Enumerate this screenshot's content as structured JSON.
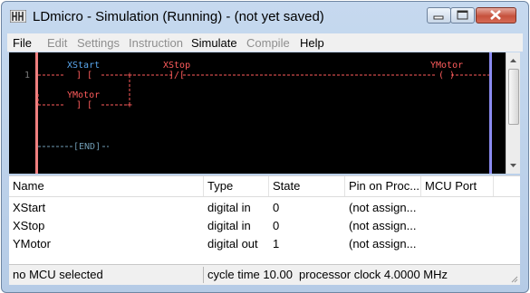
{
  "window": {
    "title": "LDmicro - Simulation (Running) - (not yet saved)"
  },
  "menu": [
    {
      "label": "File",
      "enabled": true
    },
    {
      "label": "Edit",
      "enabled": false
    },
    {
      "label": "Settings",
      "enabled": false
    },
    {
      "label": "Instruction",
      "enabled": false
    },
    {
      "label": "Simulate",
      "enabled": true
    },
    {
      "label": "Compile",
      "enabled": false
    },
    {
      "label": "Help",
      "enabled": true
    }
  ],
  "ladder": {
    "rung_number": "1",
    "xstart_name": "XStart",
    "xstart_symbol": "] [",
    "xstop_name": "XStop",
    "xstop_symbol": "]/[",
    "ymotor_coil_name": "YMotor",
    "ymotor_coil_symbol": "( )",
    "ymotor_contact_name": "YMotor",
    "ymotor_contact_symbol": "] [",
    "end_label": "[END]",
    "energized_color": "#ff5c5c",
    "dead_color": "#6f9bb3",
    "name_color": "#5aa8f0"
  },
  "table": {
    "columns": [
      "Name",
      "Type",
      "State",
      "Pin on Proc...",
      "MCU Port"
    ],
    "rows": [
      {
        "name": "XStart",
        "type": "digital in",
        "state": "0",
        "pin": "(not assign...",
        "port": ""
      },
      {
        "name": "XStop",
        "type": "digital in",
        "state": "0",
        "pin": "(not assign...",
        "port": ""
      },
      {
        "name": "YMotor",
        "type": "digital out",
        "state": "1",
        "pin": "(not assign...",
        "port": ""
      }
    ]
  },
  "status": {
    "mcu": "no MCU selected",
    "cycle": "cycle time 10.00 r",
    "clock": "processor clock 4.0000 MHz"
  },
  "colors": {
    "left_rail": "#f08080",
    "right_rail": "#8a8af0",
    "accent_title_bar": "#b9cfe9"
  }
}
